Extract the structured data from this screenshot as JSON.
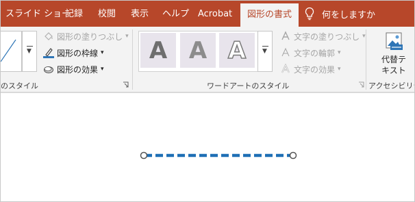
{
  "tabs": [
    {
      "label": "スライド ショー"
    },
    {
      "label": "記録"
    },
    {
      "label": "校閲"
    },
    {
      "label": "表示"
    },
    {
      "label": "ヘルプ"
    },
    {
      "label": "Acrobat"
    },
    {
      "label": "図形の書式"
    }
  ],
  "tell_me": "何をしますか",
  "ribbon": {
    "shape_styles": {
      "group_label": "のスタイル",
      "fill_label": "図形の塗りつぶし",
      "outline_label": "図形の枠線",
      "effects_label": "図形の効果"
    },
    "wordart": {
      "group_label": "ワードアートのスタイル",
      "sample_letter": "A",
      "text_fill_label": "文字の塗りつぶし",
      "text_outline_label": "文字の輪郭",
      "text_effects_label": "文字の効果"
    },
    "accessibility": {
      "group_label": "アクセシビリティ",
      "alt_text_line1": "代替テ",
      "alt_text_line2": "キスト"
    }
  },
  "colors": {
    "tab_bar": "#b7472a",
    "outline_swatch": "#2e75b6",
    "dashed_line": "#1f6fb5"
  }
}
